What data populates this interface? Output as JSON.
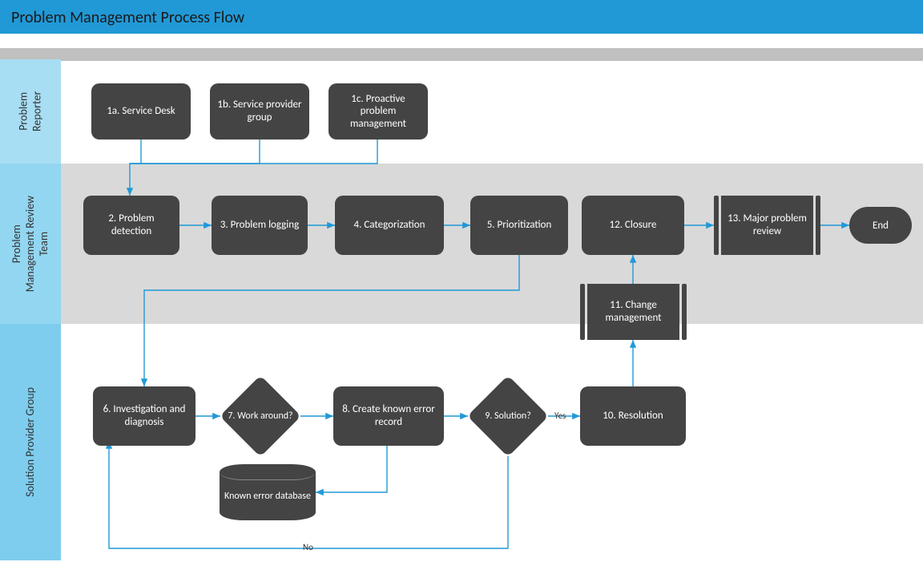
{
  "title": "Problem Management Process Flow",
  "lanes": {
    "lane1": "Problem\nReporter",
    "lane2": "Problem\nManagement Review\nTeam",
    "lane3": "Solution Provider Group"
  },
  "nodes": {
    "n1a": "1a. Service Desk",
    "n1b": "1b. Service provider group",
    "n1c": "1c. Proactive problem management",
    "n2": "2. Problem detection",
    "n3": "3. Problem logging",
    "n4": "4. Categorization",
    "n5": "5. Prioritization",
    "n6": "6. Investigation and diagnosis",
    "n7": "7. Work around?",
    "n8": "8. Create known error record",
    "n9": "9. Solution?",
    "n10": "10. Resolution",
    "n11": "11. Change management",
    "n12": "12. Closure",
    "n13": "13. Major problem review",
    "db": "Known error database",
    "end": "End"
  },
  "edges": {
    "yes": "Yes",
    "no": "No"
  },
  "chart_data": {
    "type": "swimlane-flowchart",
    "title": "Problem Management Process Flow",
    "lanes": [
      {
        "id": "reporter",
        "name": "Problem Reporter"
      },
      {
        "id": "review",
        "name": "Problem Management Review Team"
      },
      {
        "id": "provider",
        "name": "Solution Provider Group"
      }
    ],
    "nodes": [
      {
        "id": "1a",
        "label": "1a. Service Desk",
        "type": "process",
        "lane": "reporter"
      },
      {
        "id": "1b",
        "label": "1b. Service provider group",
        "type": "process",
        "lane": "reporter"
      },
      {
        "id": "1c",
        "label": "1c. Proactive problem management",
        "type": "process",
        "lane": "reporter"
      },
      {
        "id": "2",
        "label": "2. Problem detection",
        "type": "process",
        "lane": "review"
      },
      {
        "id": "3",
        "label": "3. Problem logging",
        "type": "process",
        "lane": "review"
      },
      {
        "id": "4",
        "label": "4. Categorization",
        "type": "process",
        "lane": "review"
      },
      {
        "id": "5",
        "label": "5. Prioritization",
        "type": "process",
        "lane": "review"
      },
      {
        "id": "6",
        "label": "6. Investigation and diagnosis",
        "type": "process",
        "lane": "provider"
      },
      {
        "id": "7",
        "label": "7. Work around?",
        "type": "decision",
        "lane": "provider"
      },
      {
        "id": "8",
        "label": "8. Create known error record",
        "type": "process",
        "lane": "provider"
      },
      {
        "id": "db",
        "label": "Known error database",
        "type": "datastore",
        "lane": "provider"
      },
      {
        "id": "9",
        "label": "9. Solution?",
        "type": "decision",
        "lane": "provider"
      },
      {
        "id": "10",
        "label": "10. Resolution",
        "type": "process",
        "lane": "provider"
      },
      {
        "id": "11",
        "label": "11. Change management",
        "type": "subprocess",
        "lane": "provider"
      },
      {
        "id": "12",
        "label": "12. Closure",
        "type": "process",
        "lane": "review"
      },
      {
        "id": "13",
        "label": "13. Major problem review",
        "type": "subprocess",
        "lane": "review"
      },
      {
        "id": "end",
        "label": "End",
        "type": "terminator",
        "lane": "review"
      }
    ],
    "edges": [
      {
        "from": "1a",
        "to": "2"
      },
      {
        "from": "1b",
        "to": "2"
      },
      {
        "from": "1c",
        "to": "2"
      },
      {
        "from": "2",
        "to": "3"
      },
      {
        "from": "3",
        "to": "4"
      },
      {
        "from": "4",
        "to": "5"
      },
      {
        "from": "5",
        "to": "6"
      },
      {
        "from": "6",
        "to": "7"
      },
      {
        "from": "7",
        "to": "8"
      },
      {
        "from": "8",
        "to": "db"
      },
      {
        "from": "8",
        "to": "9"
      },
      {
        "from": "9",
        "to": "10",
        "label": "Yes"
      },
      {
        "from": "9",
        "to": "6",
        "label": "No"
      },
      {
        "from": "10",
        "to": "11"
      },
      {
        "from": "11",
        "to": "12"
      },
      {
        "from": "12",
        "to": "13"
      },
      {
        "from": "13",
        "to": "end"
      }
    ]
  }
}
